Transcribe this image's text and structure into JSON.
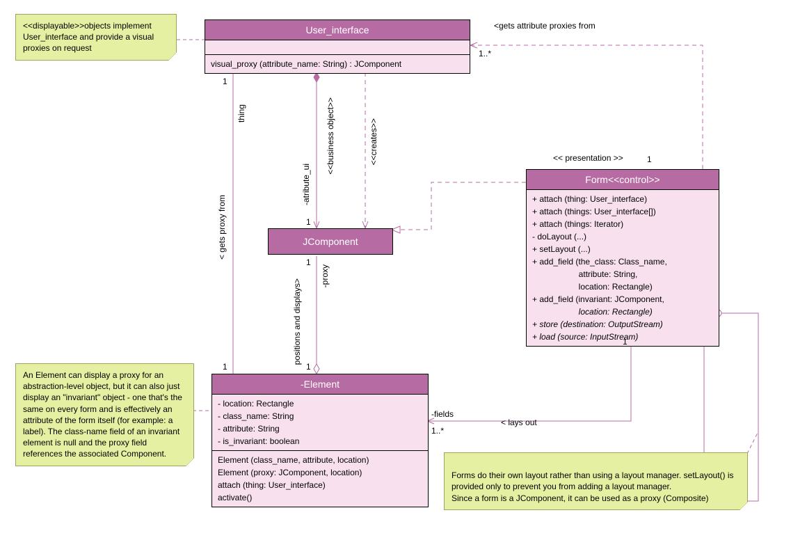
{
  "classes": {
    "user_interface": {
      "name": "User_interface",
      "ops": [
        "visual_proxy (attribute_name: String) : JComponent"
      ]
    },
    "jcomponent": {
      "name": "JComponent"
    },
    "element": {
      "name": "-Element",
      "attrs": [
        "- location: Rectangle",
        "- class_name: String",
        "- attribute: String",
        "- is_invariant: boolean"
      ],
      "ops": [
        "Element (class_name, attribute, location)",
        "Element (proxy: JComponent, location)",
        "attach (thing: User_interface)",
        "activate()"
      ]
    },
    "form": {
      "name": "Form<<control>>",
      "ops": [
        "+ attach (thing: User_interface)",
        "+ attach (things: User_interface[])",
        "+ attach (things: Iterator)",
        "- doLayout (...)",
        "+ setLayout (...)",
        "+ add_field (the_class: Class_name,",
        "                    attribute: String,",
        "                    location: Rectangle)",
        "+ add_field (invariant: JComponent,",
        "                    location: Rectangle)",
        "+ store (destination: OutputStream)",
        "+ load (source: InputStream)"
      ]
    }
  },
  "notes": {
    "n1": "<<displayable>>objects implement User_interface and provide a visual proxies on request",
    "n2": "An Element can display a proxy for an abstraction-level object, but it can also just display an \"invariant\" object - one that's the same on every form and is effectively an attribute of the form itself (for example: a label). The class-name field of an invariant element is null and the proxy field references the associated Component.",
    "n3": "Forms do their own layout rather than using a layout manager. setLayout() is provided only to prevent you from adding a layout manager.\nSince a form is a JComponent, it can be used as a proxy (Composite)"
  },
  "labels": {
    "gets_proxies": "<gets attribute proxies from",
    "mult_1star": "1..*",
    "mult_1": "1",
    "thing": "thing",
    "business_object": "<<business object>>",
    "creates": "<<creates>>",
    "atribute_ui": "-atribute_ui",
    "gets_proxy_from": "< gets proxy from",
    "positions_displays": "positions and displays>",
    "proxy": "-proxy",
    "presentation": "<< presentation >>",
    "fields": "-fields",
    "lays_out": "< lays out"
  },
  "chart_data": {
    "type": "uml_class_diagram",
    "classes": [
      {
        "id": "User_interface",
        "stereotype": null,
        "operations": [
          "visual_proxy(attribute_name:String):JComponent"
        ]
      },
      {
        "id": "JComponent"
      },
      {
        "id": "Element",
        "visibility": "-",
        "attributes": [
          "-location:Rectangle",
          "-class_name:String",
          "-attribute:String",
          "-is_invariant:boolean"
        ],
        "operations": [
          "Element(class_name,attribute,location)",
          "Element(proxy:JComponent,location)",
          "attach(thing:User_interface)",
          "activate()"
        ]
      },
      {
        "id": "Form",
        "stereotype": "control",
        "operations": [
          "+attach(thing:User_interface)",
          "+attach(things:User_interface[])",
          "+attach(things:Iterator)",
          "-doLayout(...)",
          "+setLayout(...)",
          "+add_field(the_class:Class_name,attribute:String,location:Rectangle)",
          "+add_field(invariant:JComponent,location:Rectangle)",
          "+store(destination:OutputStream)",
          "+load(source:InputStream)"
        ]
      }
    ],
    "relationships": [
      {
        "from": "Form",
        "to": "User_interface",
        "type": "dependency",
        "label": "gets attribute proxies from",
        "multiplicity_to": "1..*"
      },
      {
        "from": "Element",
        "to": "User_interface",
        "type": "association",
        "label": "gets proxy from",
        "role_to": "thing",
        "multiplicity_from": "1",
        "multiplicity_to": "1"
      },
      {
        "from": "User_interface",
        "to": "JComponent",
        "type": "composition",
        "stereotype": "business object",
        "role_to": "-atribute_ui",
        "multiplicity_to": "1"
      },
      {
        "from": "User_interface",
        "to": "JComponent",
        "type": "dependency",
        "stereotype": "creates"
      },
      {
        "from": "Element",
        "to": "JComponent",
        "type": "aggregation",
        "label": "positions and displays",
        "role_to": "-proxy",
        "multiplicity_from": "1",
        "multiplicity_to": "1"
      },
      {
        "from": "Form",
        "to": "JComponent",
        "type": "realization",
        "stereotype": "presentation",
        "multiplicity_from": "1"
      },
      {
        "from": "Form",
        "to": "Element",
        "type": "aggregation",
        "label": "lays out",
        "role_to": "-fields",
        "multiplicity_from": "1",
        "multiplicity_to": "1..*"
      },
      {
        "from": "Form",
        "to": "Form",
        "type": "aggregation",
        "self": true
      }
    ],
    "notes": [
      {
        "target": "User_interface",
        "text": "<<displayable>> objects implement User_interface and provide a visual proxies on request"
      },
      {
        "target": "Element",
        "text": "Element can display a proxy for an abstraction-level object or an invariant object..."
      },
      {
        "target": "Form",
        "text": "Forms do their own layout rather than using a layout manager..."
      }
    ]
  }
}
